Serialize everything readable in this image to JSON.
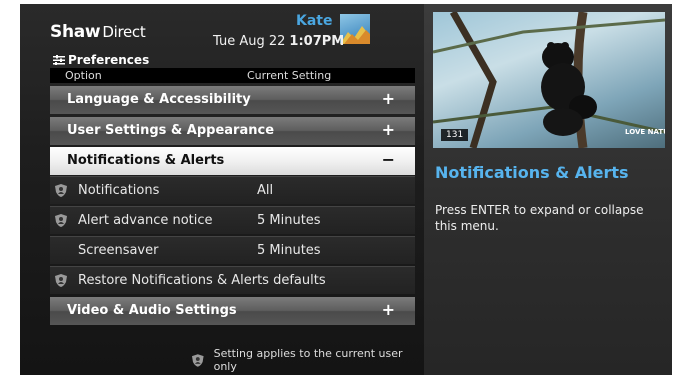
{
  "brand": {
    "name": "Shaw",
    "sub": "Direct"
  },
  "user": {
    "name": "Kate"
  },
  "datetime": {
    "date": "Tue Aug 22",
    "time": "1:07PM"
  },
  "menu": {
    "title": "Preferences",
    "col_option": "Option",
    "col_setting": "Current Setting",
    "categories": [
      {
        "label": "Language & Accessibility",
        "symbol": "+"
      },
      {
        "label": "User Settings & Appearance",
        "symbol": "+"
      },
      {
        "label": "Notifications & Alerts",
        "symbol": "−"
      },
      {
        "label": "Video & Audio Settings",
        "symbol": "+"
      }
    ],
    "items": [
      {
        "label": "Notifications",
        "value": "All"
      },
      {
        "label": "Alert advance notice",
        "value": "5 Minutes"
      },
      {
        "label": "Screensaver",
        "value": "5 Minutes"
      },
      {
        "label": "Restore Notifications & Alerts defaults",
        "value": ""
      }
    ]
  },
  "footer": {
    "note": "Setting applies to the current user only"
  },
  "preview": {
    "channel": "131",
    "watermark": "LOVE NATURE"
  },
  "info": {
    "title": "Notifications & Alerts",
    "description": "Press ENTER to expand or collapse this menu."
  },
  "colors": {
    "accent": "#4aa6e0",
    "selected_row": "#f1f1f1"
  }
}
